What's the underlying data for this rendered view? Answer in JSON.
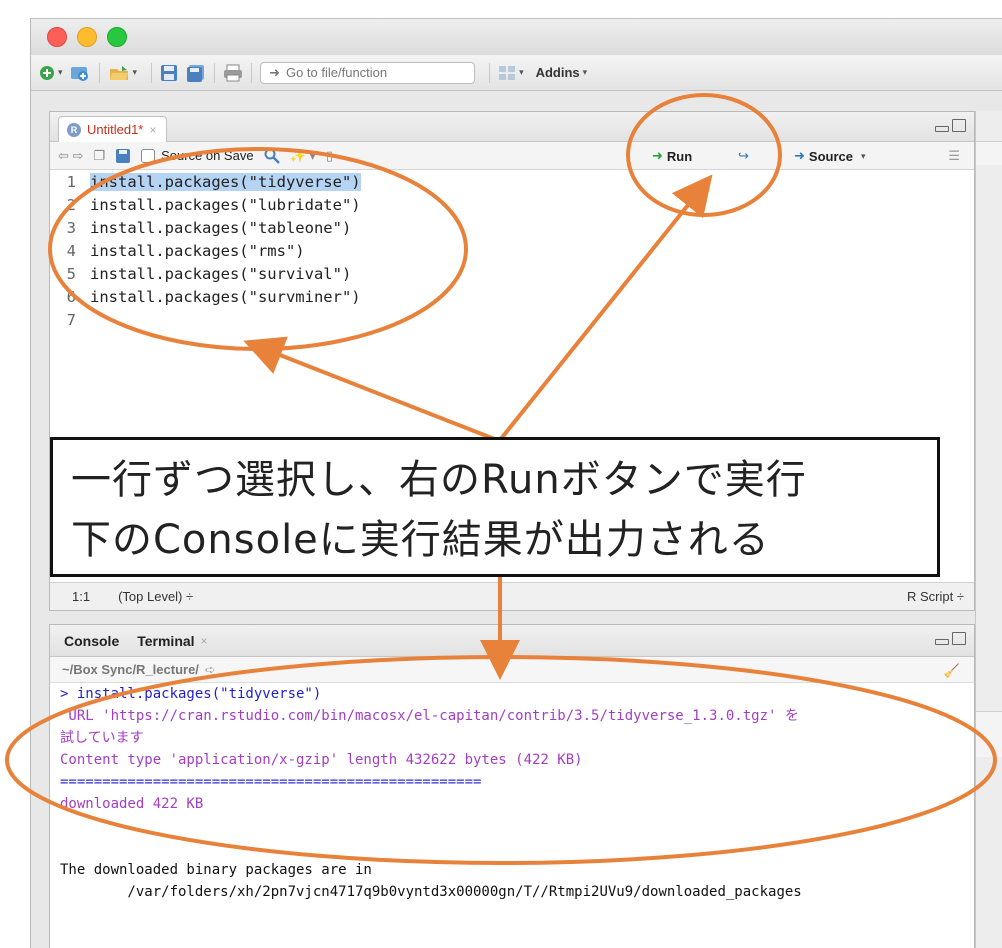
{
  "toolbar": {
    "goto_placeholder": "Go to file/function",
    "addins_label": "Addins"
  },
  "editor": {
    "tab_label": "Untitled1*",
    "source_on_save_label": "Source on Save",
    "run_label": "Run",
    "source_label": "Source",
    "lines": [
      {
        "no": "1",
        "text": "install.packages(\"tidyverse\")"
      },
      {
        "no": "2",
        "text": "install.packages(\"lubridate\")"
      },
      {
        "no": "3",
        "text": "install.packages(\"tableone\")"
      },
      {
        "no": "4",
        "text": "install.packages(\"rms\")"
      },
      {
        "no": "5",
        "text": "install.packages(\"survival\")"
      },
      {
        "no": "6",
        "text": "install.packages(\"survminer\")"
      },
      {
        "no": "7",
        "text": ""
      }
    ],
    "status": {
      "cursor": "1:1",
      "scope": "(Top Level) ÷",
      "file_type": "R Script ÷"
    }
  },
  "console": {
    "tab_console": "Console",
    "tab_terminal": "Terminal",
    "path": "~/Box Sync/R_lecture/",
    "output": [
      {
        "cls": "out-cmd",
        "text": "> install.packages(\"tidyverse\")"
      },
      {
        "cls": "out-msg",
        "text": " URL 'https://cran.rstudio.com/bin/macosx/el-capitan/contrib/3.5/tidyverse_1.3.0.tgz' を"
      },
      {
        "cls": "out-msg",
        "text": "試しています"
      },
      {
        "cls": "out-msg",
        "text": "Content type 'application/x-gzip' length 432622 bytes (422 KB)"
      },
      {
        "cls": "out-msg",
        "text": "=================================================="
      },
      {
        "cls": "out-msg",
        "text": "downloaded 422 KB"
      },
      {
        "cls": "out-normal",
        "text": ""
      },
      {
        "cls": "out-normal",
        "text": ""
      },
      {
        "cls": "out-normal",
        "text": "The downloaded binary packages are in"
      },
      {
        "cls": "out-normal",
        "text": "        /var/folders/xh/2pn7vjcn4717q9b0vyntd3x00000gn/T//Rtmpi2UVu9/downloaded_packages"
      }
    ]
  },
  "annotation": {
    "line1": "一行ずつ選択し、右のRunボタンで実行",
    "line2": "下のConsoleに実行結果が出力される"
  },
  "colors": {
    "annotation_orange": "#e8813a",
    "selection": "#b5d3f3"
  }
}
